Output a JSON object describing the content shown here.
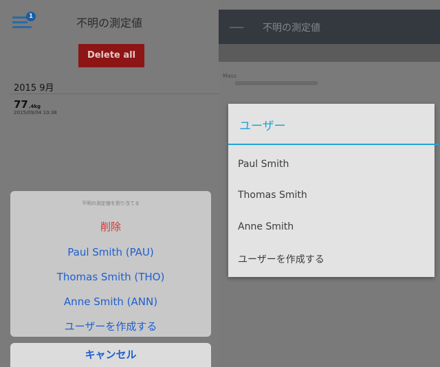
{
  "left": {
    "title": "不明の測定値",
    "menu_badge": "1",
    "delete_all_label": "Delete all",
    "month_header": "2015 9月",
    "measurement": {
      "weight": "77",
      "unit": ".4kg",
      "datetime": "2015/09/04 10:38"
    },
    "action_sheet": {
      "header": "不明の測定値を割り当てる",
      "delete_label": "削除",
      "options": [
        "Paul Smith (PAU)",
        "Thomas Smith (THO)",
        "Anne Smith (ANN)",
        "ユーザーを作成する"
      ],
      "cancel_label": "キャンセル"
    },
    "colors": {
      "accent": "#1e5fd1",
      "destructive": "#d63434",
      "button": "#8d1515"
    }
  },
  "right": {
    "appbar_title": "不明の測定値",
    "row_label": "Mass",
    "dialog": {
      "title": "ユーザー",
      "items": [
        "Paul Smith",
        "Thomas Smith",
        "Anne Smith",
        "ユーザーを作成する"
      ]
    },
    "colors": {
      "accent": "#1fa3d6",
      "appbar": "#33393e"
    }
  }
}
